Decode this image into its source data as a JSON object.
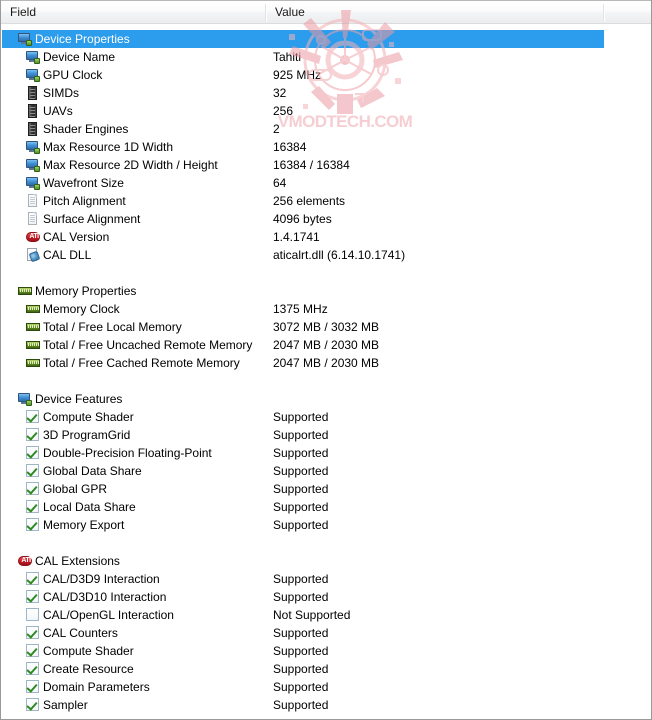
{
  "header": {
    "columns": [
      {
        "label": "Field"
      },
      {
        "label": "Value"
      },
      {
        "label": ""
      }
    ]
  },
  "watermark": {
    "text": "VMODTECH.COM",
    "color": "#f0a7ae"
  },
  "colors": {
    "selection": "#2c9cec",
    "selection_text": "#ffffff",
    "text": "#000000",
    "border": "#9a9a9a",
    "header_divider": "#dcdcdc",
    "check_green": "#2f8a23",
    "ati_red": "#c41d26"
  },
  "rows": [
    {
      "level": 0,
      "icon": "monitor-icon",
      "field": "Device Properties",
      "value": "",
      "selected": true
    },
    {
      "level": 1,
      "icon": "monitor-icon",
      "field": "Device Name",
      "value": "Tahiti",
      "selected": false
    },
    {
      "level": 1,
      "icon": "monitor-icon",
      "field": "GPU Clock",
      "value": "925 MHz",
      "selected": false
    },
    {
      "level": 1,
      "icon": "chip-icon",
      "field": "SIMDs",
      "value": "32",
      "selected": false
    },
    {
      "level": 1,
      "icon": "chip-icon",
      "field": "UAVs",
      "value": "256",
      "selected": false
    },
    {
      "level": 1,
      "icon": "chip-icon",
      "field": "Shader Engines",
      "value": "2",
      "selected": false
    },
    {
      "level": 1,
      "icon": "monitor-icon",
      "field": "Max Resource 1D Width",
      "value": "16384",
      "selected": false
    },
    {
      "level": 1,
      "icon": "monitor-icon",
      "field": "Max Resource 2D Width / Height",
      "value": "16384 / 16384",
      "selected": false
    },
    {
      "level": 1,
      "icon": "monitor-icon",
      "field": "Wavefront Size",
      "value": "64",
      "selected": false
    },
    {
      "level": 1,
      "icon": "document-icon",
      "field": "Pitch Alignment",
      "value": "256 elements",
      "selected": false
    },
    {
      "level": 1,
      "icon": "document-icon",
      "field": "Surface Alignment",
      "value": "4096 bytes",
      "selected": false
    },
    {
      "level": 1,
      "icon": "ati-logo-icon",
      "field": "CAL Version",
      "value": "1.4.1741",
      "selected": false
    },
    {
      "level": 1,
      "icon": "dll-file-icon",
      "field": "CAL DLL",
      "value": "aticalrt.dll (6.14.10.1741)",
      "selected": false
    },
    {
      "level": -1,
      "icon": "",
      "field": "",
      "value": "",
      "selected": false
    },
    {
      "level": 0,
      "icon": "memory-icon",
      "field": "Memory Properties",
      "value": "",
      "selected": false
    },
    {
      "level": 1,
      "icon": "memory-icon",
      "field": "Memory Clock",
      "value": "1375 MHz",
      "selected": false
    },
    {
      "level": 1,
      "icon": "memory-icon",
      "field": "Total / Free Local Memory",
      "value": "3072 MB / 3032 MB",
      "selected": false
    },
    {
      "level": 1,
      "icon": "memory-icon",
      "field": "Total / Free Uncached Remote Memory",
      "value": "2047 MB / 2030 MB",
      "selected": false
    },
    {
      "level": 1,
      "icon": "memory-icon",
      "field": "Total / Free Cached Remote Memory",
      "value": "2047 MB / 2030 MB",
      "selected": false
    },
    {
      "level": -1,
      "icon": "",
      "field": "",
      "value": "",
      "selected": false
    },
    {
      "level": 0,
      "icon": "monitor-icon",
      "field": "Device Features",
      "value": "",
      "selected": false
    },
    {
      "level": 1,
      "icon": "checkbox-checked-icon",
      "field": "Compute Shader",
      "value": "Supported",
      "selected": false
    },
    {
      "level": 1,
      "icon": "checkbox-checked-icon",
      "field": "3D ProgramGrid",
      "value": "Supported",
      "selected": false
    },
    {
      "level": 1,
      "icon": "checkbox-checked-icon",
      "field": "Double-Precision Floating-Point",
      "value": "Supported",
      "selected": false
    },
    {
      "level": 1,
      "icon": "checkbox-checked-icon",
      "field": "Global Data Share",
      "value": "Supported",
      "selected": false
    },
    {
      "level": 1,
      "icon": "checkbox-checked-icon",
      "field": "Global GPR",
      "value": "Supported",
      "selected": false
    },
    {
      "level": 1,
      "icon": "checkbox-checked-icon",
      "field": "Local Data Share",
      "value": "Supported",
      "selected": false
    },
    {
      "level": 1,
      "icon": "checkbox-checked-icon",
      "field": "Memory Export",
      "value": "Supported",
      "selected": false
    },
    {
      "level": -1,
      "icon": "",
      "field": "",
      "value": "",
      "selected": false
    },
    {
      "level": 0,
      "icon": "ati-logo-icon",
      "field": "CAL Extensions",
      "value": "",
      "selected": false
    },
    {
      "level": 1,
      "icon": "checkbox-checked-icon",
      "field": "CAL/D3D9 Interaction",
      "value": "Supported",
      "selected": false
    },
    {
      "level": 1,
      "icon": "checkbox-checked-icon",
      "field": "CAL/D3D10 Interaction",
      "value": "Supported",
      "selected": false
    },
    {
      "level": 1,
      "icon": "checkbox-unchecked-icon",
      "field": "CAL/OpenGL Interaction",
      "value": "Not Supported",
      "selected": false
    },
    {
      "level": 1,
      "icon": "checkbox-checked-icon",
      "field": "CAL Counters",
      "value": "Supported",
      "selected": false
    },
    {
      "level": 1,
      "icon": "checkbox-checked-icon",
      "field": "Compute Shader",
      "value": "Supported",
      "selected": false
    },
    {
      "level": 1,
      "icon": "checkbox-checked-icon",
      "field": "Create Resource",
      "value": "Supported",
      "selected": false
    },
    {
      "level": 1,
      "icon": "checkbox-checked-icon",
      "field": "Domain Parameters",
      "value": "Supported",
      "selected": false
    },
    {
      "level": 1,
      "icon": "checkbox-checked-icon",
      "field": "Sampler",
      "value": "Supported",
      "selected": false
    }
  ]
}
